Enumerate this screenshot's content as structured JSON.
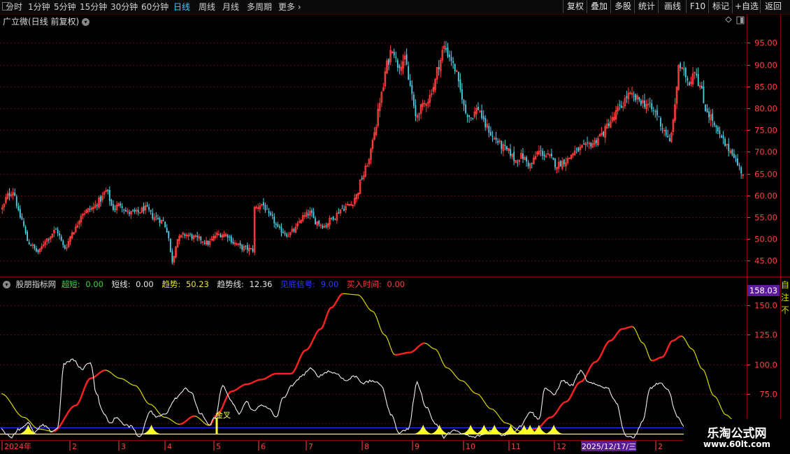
{
  "toolbar": {
    "left_items": [
      {
        "label": "分时",
        "active": false
      },
      {
        "label": "1分钟",
        "active": false
      },
      {
        "label": "5分钟",
        "active": false
      },
      {
        "label": "15分钟",
        "active": false
      },
      {
        "label": "30分钟",
        "active": false
      },
      {
        "label": "60分钟",
        "active": false
      },
      {
        "label": "日线",
        "active": true
      },
      {
        "label": "周线",
        "active": false
      },
      {
        "label": "月线",
        "active": false
      },
      {
        "label": "多周期",
        "active": false
      },
      {
        "label": "更多",
        "active": false
      }
    ],
    "right_items": [
      "复权",
      "叠加",
      "多股",
      "统计",
      "画线",
      "F10",
      "标记",
      "+自选",
      "返回"
    ]
  },
  "main_panel": {
    "title": "广立微(日线 前复权)"
  },
  "indicator_panel": {
    "name": "股朋指标网",
    "items": [
      {
        "label": "超短:",
        "value": "0.00",
        "color": "#3cd83c"
      },
      {
        "label": "短线:",
        "value": "0.00",
        "color": "#e6e6e6"
      },
      {
        "label": "趋势:",
        "value": "50.23",
        "color": "#e8e63c"
      },
      {
        "label": "趋势线:",
        "value": "12.36",
        "color": "#e6e6e6"
      },
      {
        "label": "见底信号:",
        "value": "9.00",
        "color": "#2a3cff"
      },
      {
        "label": "买入时间:",
        "value": "0.00",
        "color": "#ff3c3c"
      }
    ],
    "signal_label": "金叉",
    "current_value": "158.03"
  },
  "time_axis": {
    "labels": [
      "2024年",
      "2",
      "3",
      "4",
      "5",
      "6",
      "7",
      "8",
      "9",
      "10",
      "11",
      "12",
      "2025/12/17/三",
      "2"
    ]
  },
  "right_edge_glyphs": [
    "自",
    "注",
    "不"
  ],
  "watermark": {
    "title": "乐淘公式网",
    "url": "www.60lt.com"
  },
  "colors": {
    "up": "#ff3c3c",
    "down": "#4ad2e6",
    "axis_red": "#ff4040",
    "grid": "#5a0a0a",
    "trend_red": "#ff2020",
    "trend_yellow": "#d8d800",
    "short_white": "#f0f0f0",
    "baseline_blue": "#2233ff",
    "signal_yellow": "#ffff30"
  },
  "chart_data": [
    {
      "type": "candlestick",
      "title": "广立微(日线 前复权)",
      "y_ticks": [
        45,
        50,
        55,
        60,
        65,
        70,
        75,
        80,
        85,
        90,
        95
      ],
      "ylim": [
        42,
        101
      ],
      "n_days": 283,
      "close_anchors": [
        [
          0,
          57
        ],
        [
          3,
          60
        ],
        [
          6,
          61
        ],
        [
          10,
          55
        ],
        [
          15,
          49
        ],
        [
          20,
          47
        ],
        [
          25,
          50
        ],
        [
          30,
          52
        ],
        [
          35,
          48
        ],
        [
          40,
          52
        ],
        [
          45,
          56
        ],
        [
          50,
          57
        ],
        [
          55,
          59
        ],
        [
          58,
          61
        ],
        [
          62,
          57
        ],
        [
          66,
          58
        ],
        [
          70,
          56
        ],
        [
          75,
          56
        ],
        [
          80,
          57
        ],
        [
          85,
          55
        ],
        [
          90,
          54
        ],
        [
          92,
          52
        ],
        [
          95,
          45
        ],
        [
          98,
          50
        ],
        [
          102,
          51
        ],
        [
          110,
          50
        ],
        [
          115,
          49
        ],
        [
          120,
          51
        ],
        [
          125,
          51
        ],
        [
          130,
          49
        ],
        [
          134,
          48
        ],
        [
          140,
          47.5
        ],
        [
          141,
          57
        ],
        [
          145,
          58
        ],
        [
          150,
          55
        ],
        [
          155,
          52
        ],
        [
          160,
          51
        ],
        [
          163,
          52
        ],
        [
          168,
          55
        ],
        [
          172,
          56
        ],
        [
          175,
          54
        ],
        [
          180,
          53
        ],
        [
          185,
          55
        ],
        [
          190,
          57
        ],
        [
          195,
          58
        ],
        [
          198,
          60
        ],
        [
          201,
          64
        ],
        [
          205,
          68
        ],
        [
          208,
          75
        ],
        [
          212,
          83
        ],
        [
          215,
          90
        ],
        [
          218,
          94
        ],
        [
          221,
          90
        ],
        [
          225,
          91
        ],
        [
          228,
          85
        ],
        [
          231,
          78
        ],
        [
          234,
          80
        ],
        [
          238,
          82
        ],
        [
          241,
          85
        ],
        [
          244,
          90
        ],
        [
          247,
          94
        ],
        [
          250,
          92
        ],
        [
          253,
          89
        ],
        [
          256,
          84
        ],
        [
          259,
          79
        ],
        [
          262,
          78
        ],
        [
          266,
          80
        ]
      ]
    },
    {
      "type": "candlestick_continued",
      "close_anchors_b": [
        [
          266,
          80
        ],
        [
          270,
          76
        ],
        [
          275,
          73
        ],
        [
          280,
          71
        ],
        [
          283,
          70
        ],
        [
          287,
          68
        ],
        [
          290,
          69
        ],
        [
          295,
          67
        ],
        [
          300,
          70
        ],
        [
          305,
          69
        ],
        [
          310,
          67
        ],
        [
          315,
          68
        ],
        [
          320,
          70
        ],
        [
          325,
          71
        ],
        [
          330,
          72
        ],
        [
          335,
          74
        ],
        [
          340,
          77
        ],
        [
          345,
          80
        ],
        [
          350,
          83
        ],
        [
          355,
          82
        ],
        [
          360,
          81
        ],
        [
          365,
          79
        ],
        [
          370,
          75
        ],
        [
          373,
          72
        ],
        [
          376,
          80
        ],
        [
          378,
          90
        ],
        [
          381,
          88
        ],
        [
          384,
          86
        ],
        [
          387,
          89
        ],
        [
          390,
          85
        ],
        [
          393,
          80
        ],
        [
          396,
          78
        ],
        [
          399,
          75
        ],
        [
          402,
          73
        ],
        [
          405,
          71
        ],
        [
          408,
          70
        ],
        [
          411,
          67
        ],
        [
          414,
          65
        ]
      ],
      "total_days": 415
    },
    {
      "type": "line",
      "title": "股朋指标网",
      "y_ticks": [
        50,
        75,
        100,
        125,
        150
      ],
      "ylim": [
        38,
        165
      ],
      "series": [
        {
          "name": "趋势",
          "color_rule": "red when rising, yellow when falling",
          "anchors": [
            [
              0,
              75
            ],
            [
              15,
              55
            ],
            [
              25,
              45
            ],
            [
              35,
              43
            ],
            [
              50,
              65
            ],
            [
              60,
              88
            ],
            [
              70,
              95
            ],
            [
              80,
              88
            ],
            [
              90,
              82
            ],
            [
              100,
              66
            ],
            [
              110,
              55
            ],
            [
              120,
              49
            ],
            [
              130,
              56
            ],
            [
              140,
              48
            ],
            [
              145,
              57
            ],
            [
              155,
              77
            ],
            [
              165,
              83
            ],
            [
              175,
              87
            ],
            [
              185,
              92
            ],
            [
              195,
              92
            ],
            [
              205,
              112
            ],
            [
              215,
              130
            ],
            [
              222,
              148
            ],
            [
              230,
              160
            ],
            [
              240,
              159
            ],
            [
              250,
              145
            ],
            [
              258,
              125
            ],
            [
              265,
              108
            ],
            [
              275,
              110
            ],
            [
              285,
              118
            ],
            [
              292,
              113
            ],
            [
              300,
              97
            ],
            [
              310,
              86
            ],
            [
              320,
              75
            ],
            [
              330,
              62
            ],
            [
              340,
              50
            ],
            [
              350,
              43
            ],
            [
              360,
              45
            ],
            [
              370,
              55
            ],
            [
              380,
              68
            ],
            [
              390,
              85
            ],
            [
              400,
              102
            ],
            [
              410,
              120
            ],
            [
              418,
              130
            ],
            [
              425,
              132
            ],
            [
              432,
              118
            ],
            [
              438,
              103
            ],
            [
              445,
              106
            ],
            [
              452,
              120
            ],
            [
              458,
              124
            ],
            [
              465,
              113
            ],
            [
              472,
              96
            ],
            [
              480,
              73
            ],
            [
              488,
              57
            ],
            [
              495,
              50
            ]
          ]
        },
        {
          "name": "短线",
          "anchors": [
            [
              0,
              45
            ],
            [
              6,
              38
            ],
            [
              12,
              45
            ],
            [
              18,
              50
            ],
            [
              22,
              42
            ],
            [
              28,
              48
            ],
            [
              34,
              43
            ],
            [
              38,
              46
            ],
            [
              42,
              100
            ],
            [
              48,
              104
            ],
            [
              54,
              96
            ],
            [
              60,
              102
            ],
            [
              64,
              75
            ],
            [
              68,
              60
            ],
            [
              73,
              50
            ],
            [
              78,
              55
            ],
            [
              83,
              48
            ],
            [
              88,
              47
            ],
            [
              93,
              38
            ],
            [
              100,
              60
            ],
            [
              105,
              55
            ],
            [
              110,
              58
            ],
            [
              118,
              72
            ],
            [
              124,
              80
            ],
            [
              128,
              75
            ],
            [
              134,
              58
            ],
            [
              140,
              48
            ],
            [
              144,
              55
            ],
            [
              149,
              82
            ],
            [
              155,
              68
            ],
            [
              160,
              58
            ],
            [
              165,
              68
            ],
            [
              170,
              60
            ],
            [
              175,
              66
            ],
            [
              180,
              62
            ],
            [
              185,
              55
            ],
            [
              190,
              72
            ],
            [
              196,
              82
            ],
            [
              202,
              90
            ],
            [
              208,
              96
            ],
            [
              214,
              90
            ],
            [
              220,
              94
            ],
            [
              226,
              92
            ],
            [
              232,
              86
            ],
            [
              238,
              90
            ],
            [
              244,
              84
            ],
            [
              250,
              86
            ],
            [
              256,
              82
            ],
            [
              262,
              58
            ],
            [
              268,
              42
            ],
            [
              274,
              45
            ],
            [
              280,
              84
            ],
            [
              286,
              64
            ],
            [
              292,
              50
            ],
            [
              298,
              38
            ],
            [
              304,
              44
            ],
            [
              310,
              41
            ],
            [
              318,
              38
            ],
            [
              324,
              40
            ],
            [
              330,
              44
            ],
            [
              338,
              40
            ],
            [
              344,
              42
            ],
            [
              350,
              48
            ],
            [
              356,
              60
            ],
            [
              362,
              53
            ],
            [
              366,
              80
            ],
            [
              372,
              74
            ],
            [
              378,
              86
            ],
            [
              384,
              82
            ],
            [
              390,
              94
            ],
            [
              396,
              84
            ],
            [
              402,
              82
            ],
            [
              408,
              80
            ],
            [
              414,
              68
            ],
            [
              420,
              40
            ],
            [
              426,
              38
            ],
            [
              432,
              52
            ],
            [
              437,
              80
            ],
            [
              443,
              84
            ],
            [
              449,
              78
            ],
            [
              455,
              56
            ],
            [
              460,
              46
            ],
            [
              465,
              41
            ]
          ]
        }
      ],
      "gold_cross_day": 145,
      "bottom_signal_days": [
        18,
        101,
        284,
        295,
        316,
        325,
        332,
        343,
        352,
        356,
        362,
        372
      ]
    }
  ]
}
